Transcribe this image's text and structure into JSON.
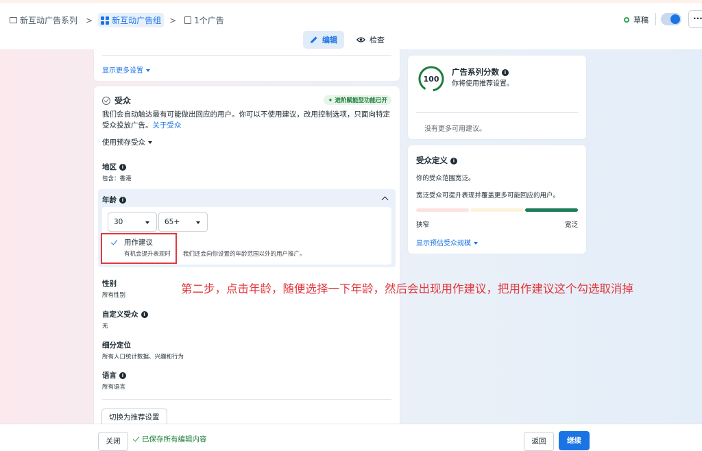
{
  "topbar": {
    "breadcrumbs": [
      {
        "label": "新互动广告系列",
        "icon": "folder-icon"
      },
      {
        "label": "新互动广告组",
        "icon": "grid-icon"
      },
      {
        "label": "1个广告",
        "icon": "document-icon"
      }
    ],
    "status": "草稿",
    "more": "···",
    "tabs": [
      {
        "label": "编辑",
        "icon": "pencil-icon"
      },
      {
        "label": "检查",
        "icon": "eye-icon"
      }
    ]
  },
  "left_top": {
    "show_more": "显示更多设置"
  },
  "audience": {
    "title": "受众",
    "badge": "进阶赋能型功能已开",
    "description": "我们会自动触达最有可能做出回应的用户。你可以不使用建议，改用控制选项，只面向特定受众投放广告。",
    "about_link": "关于受众",
    "saved_audience": "使用预存受众",
    "region": {
      "label": "地区",
      "value": "包含：香港"
    },
    "age": {
      "label": "年龄",
      "min": "30",
      "max": "65+",
      "suggest_label": "用作建议",
      "suggest_sub": "有机会提升表现时",
      "suggest_extra": "我们还会向你设置的年龄范围以外的用户推广。"
    },
    "gender": {
      "label": "性别",
      "value": "所有性别"
    },
    "custom_audience": {
      "label": "自定义受众",
      "value": "无"
    },
    "detailed": {
      "label": "细分定位",
      "value": "所有人口统计数据、兴趣和行为"
    },
    "language": {
      "label": "语言",
      "value": "所有语言"
    },
    "switch_button": "切换为推荐设置"
  },
  "annotation": "第二步，点击年龄，随便选择一下年龄，然后会出现用作建议，把用作建议这个勾选取消掉",
  "score": {
    "value": "100",
    "title": "广告系列分数",
    "subtitle": "你将使用推荐设置。",
    "none": "没有更多可用建议。"
  },
  "definition": {
    "title": "受众定义",
    "line1": "你的受众范围宽泛。",
    "line2": "宽泛受众可提升表现并覆盖更多可能回应的用户。",
    "narrow": "狭窄",
    "broad": "宽泛",
    "link": "显示预估受众规模",
    "meter_colors": [
      "#fde1e1",
      "#fdf3dc",
      "#1d7d5a"
    ]
  },
  "bottombar": {
    "close": "关闭",
    "saved": "已保存所有编辑内容",
    "back": "返回",
    "continue": "继续"
  },
  "colors": {
    "accent": "#1b74e4",
    "success": "#31a24c",
    "annotation": "#e0383e"
  }
}
